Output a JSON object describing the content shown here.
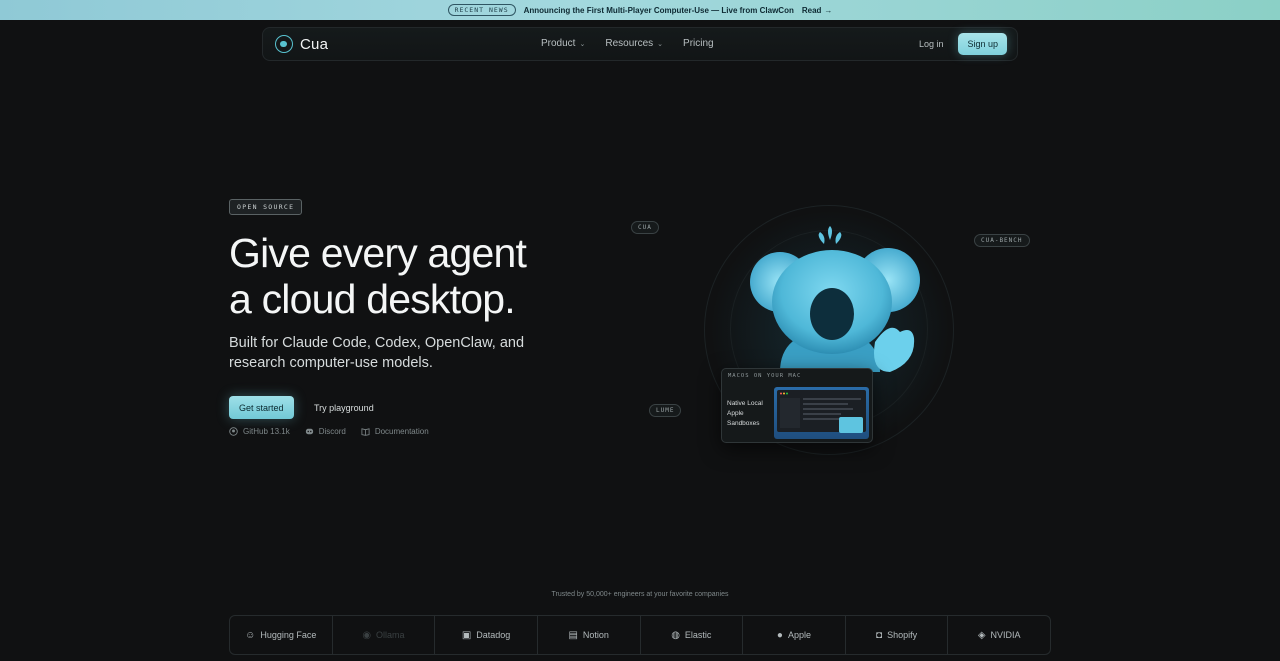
{
  "announcement": {
    "tag": "RECENT NEWS",
    "message": "Announcing the First Multi-Player Computer-Use — Live from ClawCon",
    "cta": "Read"
  },
  "nav": {
    "brand": "Cua",
    "links": [
      {
        "label": "Product",
        "has_dropdown": true
      },
      {
        "label": "Resources",
        "has_dropdown": true
      },
      {
        "label": "Pricing",
        "has_dropdown": false
      }
    ],
    "login": "Log in",
    "signup": "Sign up"
  },
  "hero": {
    "badge": "OPEN SOURCE",
    "headline_line1": "Give every agent",
    "headline_line2": "a cloud desktop.",
    "subhead_line1": "Built for Claude Code, Codex, OpenClaw, and",
    "subhead_line2": "research computer-use models.",
    "primary_cta": "Get started",
    "secondary_cta": "Try playground",
    "links": [
      {
        "icon": "github-icon",
        "label": "GitHub 13.1k"
      },
      {
        "icon": "discord-icon",
        "label": "Discord"
      },
      {
        "icon": "book-icon",
        "label": "Documentation"
      }
    ]
  },
  "graphic": {
    "pills": [
      "CUA",
      "CUA-BENCH",
      "LUME"
    ],
    "card_header": "MACOS ON YOUR MAC",
    "card_label": "Native Local Apple Sandboxes"
  },
  "trusted": {
    "caption": "Trusted by 50,000+ engineers at your favorite companies",
    "companies": [
      {
        "name": "Hugging Face",
        "icon": "hugging-face-icon",
        "dim": false
      },
      {
        "name": "Ollama",
        "icon": "ollama-icon",
        "dim": true
      },
      {
        "name": "Datadog",
        "icon": "datadog-icon",
        "dim": false
      },
      {
        "name": "Notion",
        "icon": "notion-icon",
        "dim": false
      },
      {
        "name": "Elastic",
        "icon": "elastic-icon",
        "dim": false
      },
      {
        "name": "Apple",
        "icon": "apple-icon",
        "dim": false
      },
      {
        "name": "Shopify",
        "icon": "shopify-icon",
        "dim": false
      },
      {
        "name": "NVIDIA",
        "icon": "nvidia-icon",
        "dim": false
      }
    ]
  },
  "colors": {
    "accent": "#7fd1dc",
    "background": "#101112",
    "mascot": "#5ec4e0"
  }
}
